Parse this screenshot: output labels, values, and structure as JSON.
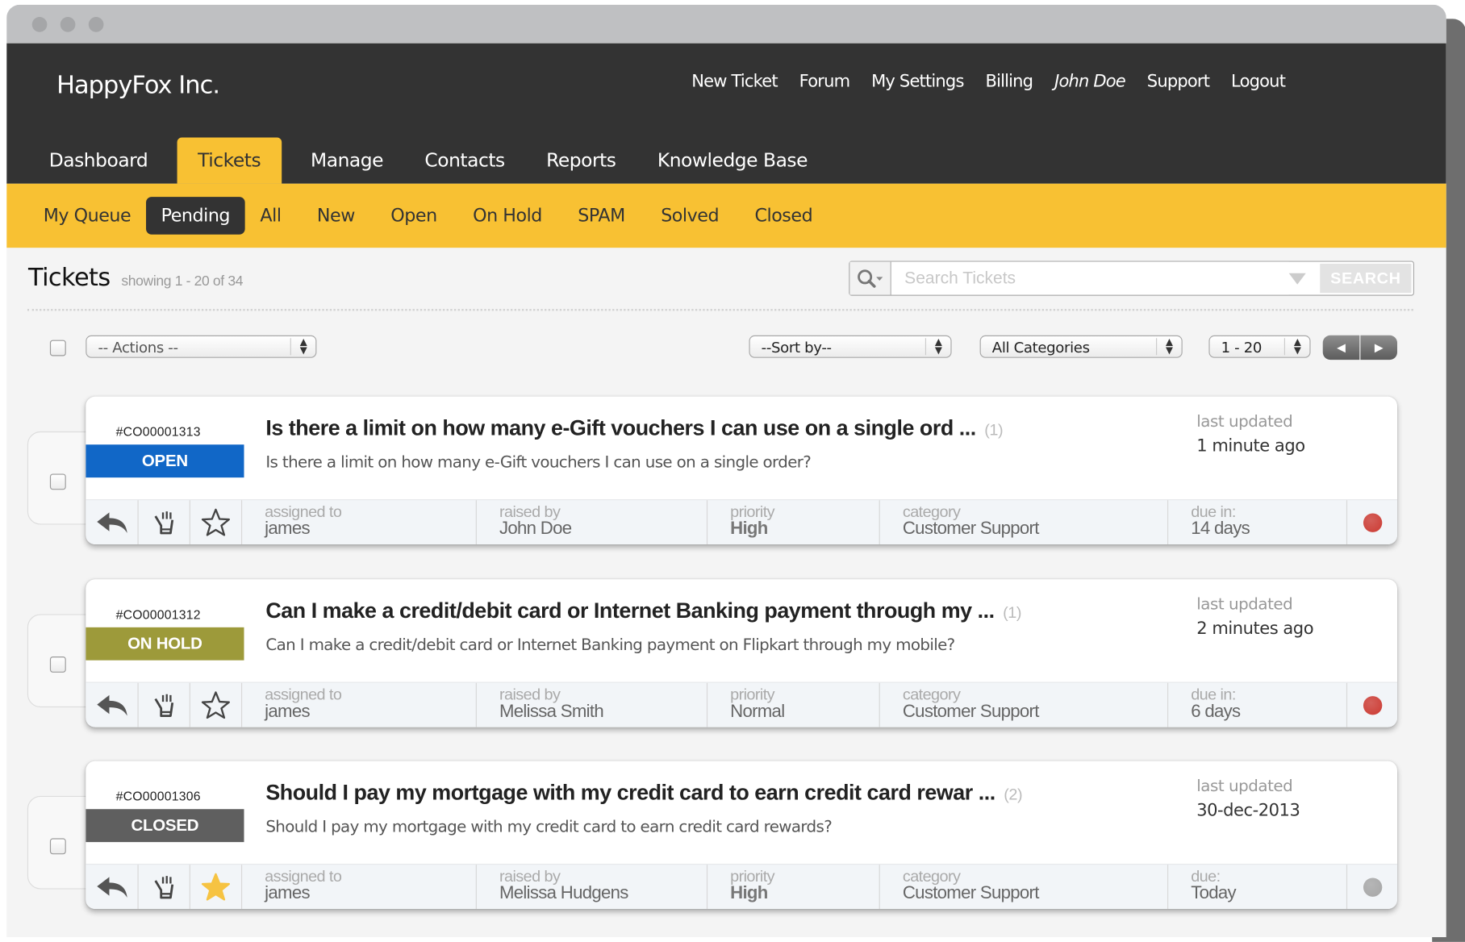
{
  "window": {
    "controls": [
      "close",
      "minimize",
      "maximize"
    ]
  },
  "header": {
    "brand": "HappyFox Inc.",
    "links": [
      {
        "label": "New Ticket"
      },
      {
        "label": "Forum"
      },
      {
        "label": "My Settings"
      },
      {
        "label": "Billing"
      },
      {
        "label": "John Doe"
      },
      {
        "label": "Support"
      },
      {
        "label": "Logout"
      }
    ],
    "tabs": [
      {
        "label": "Dashboard"
      },
      {
        "label": "Tickets",
        "active": true
      },
      {
        "label": "Manage"
      },
      {
        "label": "Contacts"
      },
      {
        "label": "Reports"
      },
      {
        "label": "Knowledge Base"
      }
    ]
  },
  "subnav": {
    "tabs": [
      {
        "label": "My Queue"
      },
      {
        "label": "Pending",
        "active": true
      },
      {
        "label": "All"
      },
      {
        "label": "New"
      },
      {
        "label": "Open"
      },
      {
        "label": "On Hold"
      },
      {
        "label": "SPAM"
      },
      {
        "label": "Solved"
      },
      {
        "label": "Closed"
      }
    ]
  },
  "page": {
    "title": "Tickets",
    "showing": "showing 1 - 20 of 34",
    "search": {
      "placeholder": "Search Tickets",
      "value": "",
      "button": "SEARCH",
      "icon": "search-icon"
    },
    "toolbar": {
      "actions": "-- Actions --",
      "sort": "--Sort by--",
      "category": "All Categories",
      "range": "1 - 20",
      "prev_icon": "◀",
      "next_icon": "▶"
    }
  },
  "colors": {
    "header_bg": "#333333",
    "accent": "#f8c133",
    "status_open": "#1167c7",
    "status_on_hold": "#9d9a3a",
    "status_closed": "#5f5f5f",
    "dot_red": "#cc3a32",
    "dot_grey": "#a6a6a6",
    "star_gold": "#f6c342"
  },
  "tickets": [
    {
      "id": "#CO00001313",
      "status": "OPEN",
      "status_color": "#1167c7",
      "subject": "Is there a limit on how many e-Gift vouchers I can use on a single ord ...",
      "replies": "(1)",
      "preview": "Is there a limit on how many e-Gift vouchers I can use on a single order?",
      "updated_label": "last updated",
      "updated": "1 minute ago",
      "starred": false,
      "assigned_label": "assigned to",
      "assigned": "james",
      "raised_label": "raised by",
      "raised": "John Doe",
      "priority_label": "priority",
      "priority": "High",
      "priority_bold": true,
      "category_label": "category",
      "category": "Customer Support",
      "due_label": "due in:",
      "due": "14 days",
      "dot_color": "#cc3a32"
    },
    {
      "id": "#CO00001312",
      "status": "ON HOLD",
      "status_color": "#9d9a3a",
      "subject": "Can I make a credit/debit card or Internet Banking payment through my ...",
      "replies": "(1)",
      "preview": "Can I make a credit/debit card or Internet Banking payment on Flipkart through my mobile?",
      "updated_label": "last updated",
      "updated": "2 minutes ago",
      "starred": false,
      "assigned_label": "assigned to",
      "assigned": "james",
      "raised_label": "raised by",
      "raised": "Melissa Smith",
      "priority_label": "priority",
      "priority": "Normal",
      "priority_bold": false,
      "category_label": "category",
      "category": "Customer Support",
      "due_label": "due in:",
      "due": "6 days",
      "dot_color": "#cc3a32"
    },
    {
      "id": "#CO00001306",
      "status": "CLOSED",
      "status_color": "#5f5f5f",
      "subject": "Should I pay my mortgage with my credit card to earn credit card rewar ...",
      "replies": "(2)",
      "preview": "Should I pay my mortgage with my credit card to earn credit card rewards?",
      "updated_label": "last updated",
      "updated": "30-dec-2013",
      "starred": true,
      "assigned_label": "assigned to",
      "assigned": "james",
      "raised_label": "raised by",
      "raised": "Melissa Hudgens",
      "priority_label": "priority",
      "priority": "High",
      "priority_bold": true,
      "category_label": "category",
      "category": "Customer Support",
      "due_label": "due:",
      "due": "Today",
      "dot_color": "#a6a6a6"
    }
  ]
}
